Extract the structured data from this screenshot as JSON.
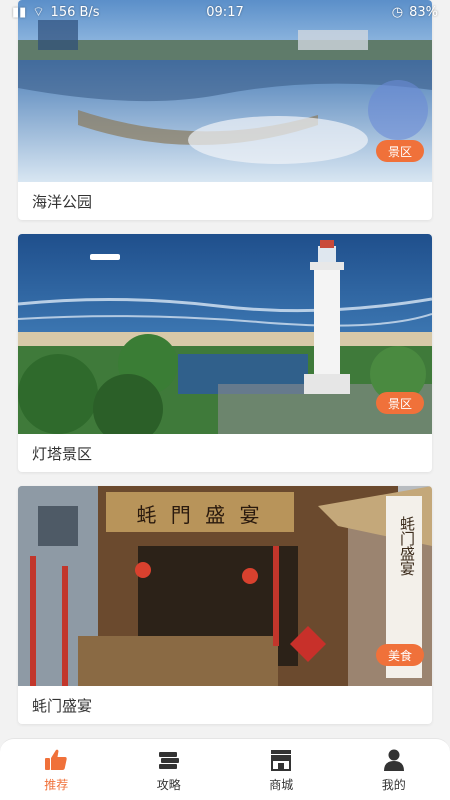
{
  "status_bar": {
    "left_text": "156 B/s",
    "time": "09:17",
    "battery": "83%"
  },
  "cards": [
    {
      "caption": "海洋公园",
      "tag": "景区"
    },
    {
      "caption": "灯塔景区",
      "tag": "景区"
    },
    {
      "caption": "蚝门盛宴",
      "tag": "美食",
      "sign_text": "蚝 門 盛 宴",
      "banner_text": "蚝门盛宴"
    }
  ],
  "colors": {
    "accent": "#f0713a",
    "tag": "#f0713a"
  },
  "tab_bar": {
    "tabs": [
      {
        "label": "推荐",
        "icon": "thumbs-up-icon",
        "active": true
      },
      {
        "label": "攻略",
        "icon": "books-icon",
        "active": false
      },
      {
        "label": "商城",
        "icon": "shop-icon",
        "active": false
      },
      {
        "label": "我的",
        "icon": "person-icon",
        "active": false
      }
    ]
  }
}
